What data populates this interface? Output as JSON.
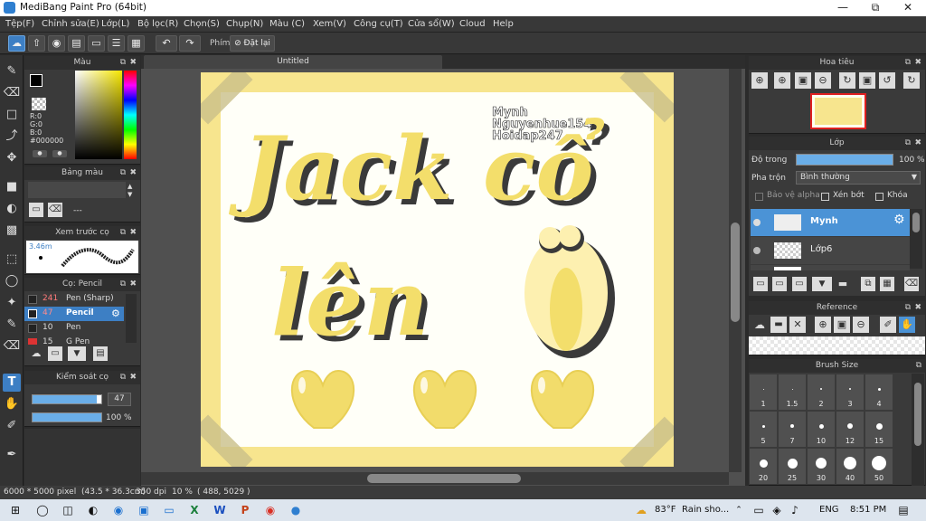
{
  "window": {
    "title": "MediBang Paint Pro (64bit)"
  },
  "menu": [
    "Tệp(F)",
    "Chỉnh sửa(E)",
    "Lớp(L)",
    "Bộ lọc(R)",
    "Chọn(S)",
    "Chụp(N)",
    "Màu (C)",
    "Xem(V)",
    "Công cụ(T)",
    "Cửa sổ(W)",
    "Cloud",
    "Help"
  ],
  "toolbar": {
    "shortcut_label": "Phím",
    "reset_label": "Đặt lại"
  },
  "panels": {
    "color": {
      "title": "Màu",
      "r": "R:0",
      "g": "G:0",
      "b": "B:0",
      "hex": "#000000",
      "primary_color": "#000000"
    },
    "palette": {
      "title": "Bảng màu",
      "value": "---"
    },
    "brush_preview": {
      "title": "Xem trước cọ",
      "size": "3.46m"
    },
    "brush": {
      "title": "Cọ: Pencil",
      "items": [
        {
          "size": "241",
          "name": "Pen (Sharp)",
          "selected": false
        },
        {
          "size": "47",
          "name": "Pencil",
          "selected": true
        },
        {
          "size": "10",
          "name": "Pen",
          "selected": false
        },
        {
          "size": "15",
          "name": "G Pen",
          "selected": false
        }
      ]
    },
    "brush_control": {
      "title": "Kiểm soát cọ",
      "size_value": "47",
      "opacity_value": "100 %",
      "size_fraction": 0.94,
      "opacity_fraction": 1.0
    }
  },
  "canvas": {
    "tab": "Untitled",
    "watermark": [
      "Mynh",
      "Nguyenhue154",
      "Hoidap247"
    ],
    "art_line1": "Jack cổ",
    "art_line2": "lên"
  },
  "navigator": {
    "title": "Hoa tiêu"
  },
  "layers": {
    "title": "Lớp",
    "opacity_label": "Độ trong",
    "opacity_value": "100 %",
    "opacity_fraction": 1.0,
    "blend_label": "Pha trộn",
    "blend_value": "Bình thường",
    "protect_alpha": "Bảo vệ alpha",
    "clipping": "Xén bớt",
    "lock": "Khóa",
    "items": [
      {
        "name": "Mynh",
        "selected": true
      },
      {
        "name": "Lớp6",
        "selected": false
      }
    ]
  },
  "reference": {
    "title": "Reference"
  },
  "brush_size": {
    "title": "Brush Size",
    "labels": [
      "1",
      "1.5",
      "2",
      "3",
      "4",
      "5",
      "7",
      "10",
      "12",
      "15",
      "20",
      "25",
      "30",
      "40",
      "50"
    ]
  },
  "status": {
    "dimensions": "6000 * 5000 pixel",
    "physical": "(43.5 * 36.3cm)",
    "dpi": "350 dpi",
    "zoom": "10 %",
    "coords": "( 488, 5029 )"
  },
  "taskbar": {
    "temperature": "83°F",
    "weather": "Rain sho...",
    "language": "ENG",
    "time": "8:51 PM"
  },
  "colors": {
    "accent": "#3d7fc4",
    "canvas_yellow": "#f7e58e",
    "heart_yellow": "#f2dc6b",
    "stroke_dark": "#3a3a3a"
  }
}
